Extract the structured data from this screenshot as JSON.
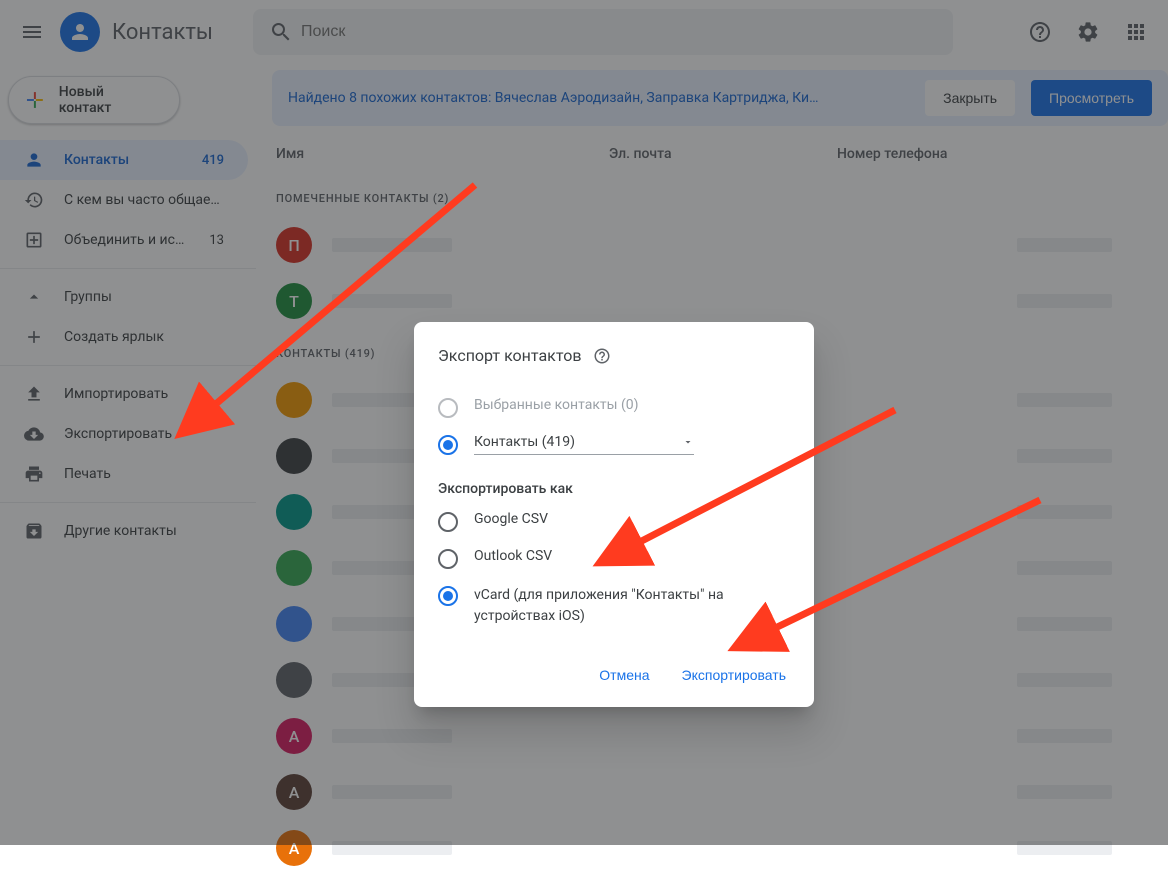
{
  "header": {
    "app_title": "Контакты",
    "search_placeholder": "Поиск"
  },
  "sidebar": {
    "new_contact": "Новый контакт",
    "items": [
      {
        "label": "Контакты",
        "count": "419"
      },
      {
        "label": "С кем вы часто общае…",
        "count": ""
      },
      {
        "label": "Объединить и испр…",
        "count": "13"
      }
    ],
    "groups_label": "Группы",
    "create_label": "Создать ярлык",
    "import_label": "Импортировать",
    "export_label": "Экспортировать",
    "print_label": "Печать",
    "other_label": "Другие контакты"
  },
  "banner": {
    "text": "Найдено 8 похожих контактов: Вячеслав Аэродизайн, Заправка Картриджа, Ки…",
    "close": "Закрыть",
    "view": "Просмотреть"
  },
  "columns": {
    "name": "Имя",
    "email": "Эл. почта",
    "phone": "Номер телефона"
  },
  "sections": {
    "starred": "ПОМЕЧЕННЫЕ КОНТАКТЫ (2)",
    "all": "КОНТАКТЫ (419)"
  },
  "starred_contacts": [
    {
      "initial": "П",
      "color": "#d93025"
    },
    {
      "initial": "Т",
      "color": "#1e8e3e"
    }
  ],
  "contacts": [
    {
      "initial": "",
      "color": "#f29900",
      "img": true
    },
    {
      "initial": "",
      "color": "#3c4043",
      "img": true
    },
    {
      "initial": "",
      "color": "#009688"
    },
    {
      "initial": "",
      "color": "#34a853"
    },
    {
      "initial": "",
      "color": "#4285f4"
    },
    {
      "initial": "",
      "color": "#5f6368"
    },
    {
      "initial": "А",
      "color": "#d81b60"
    },
    {
      "initial": "А",
      "color": "#5d4037"
    },
    {
      "initial": "А",
      "color": "#e8710a"
    }
  ],
  "dialog": {
    "title": "Экспорт контактов",
    "radio_selected_disabled": "Выбранные контакты (0)",
    "radio_contacts": "Контакты (419)",
    "section": "Экспортировать как",
    "format_google": "Google CSV",
    "format_outlook": "Outlook CSV",
    "format_vcard": "vCard (для приложения \"Контакты\" на устройствах iOS)",
    "cancel": "Отмена",
    "export": "Экспортировать"
  }
}
